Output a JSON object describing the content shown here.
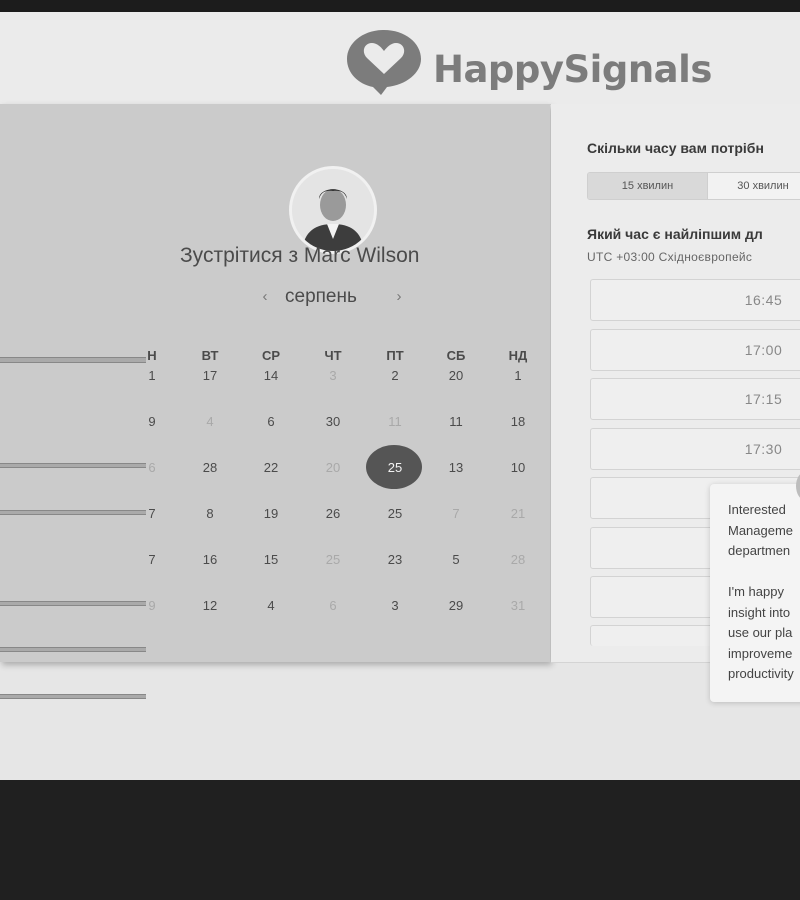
{
  "brand": {
    "name": "HappySignals"
  },
  "left": {
    "meet_title": "Зустрітися з Marc Wilson",
    "month": "серпень",
    "prev_icon": "chevron-left-icon",
    "next_icon": "chevron-right-icon",
    "weekdays": [
      "Н",
      "ВТ",
      "СР",
      "ЧТ",
      "ПТ",
      "СБ",
      "НД"
    ],
    "rows": [
      [
        {
          "d": "1",
          "dim": false
        },
        {
          "d": "17",
          "dim": false
        },
        {
          "d": "14",
          "dim": false
        },
        {
          "d": "3",
          "dim": true
        },
        {
          "d": "2",
          "dim": false
        },
        {
          "d": "20",
          "dim": false
        },
        {
          "d": "1",
          "dim": false
        }
      ],
      [
        {
          "d": "9",
          "dim": false
        },
        {
          "d": "4",
          "dim": true
        },
        {
          "d": "6",
          "dim": false
        },
        {
          "d": "30",
          "dim": false
        },
        {
          "d": "11",
          "dim": true
        },
        {
          "d": "11",
          "dim": false
        },
        {
          "d": "18",
          "dim": false
        }
      ],
      [
        {
          "d": "6",
          "dim": true
        },
        {
          "d": "28",
          "dim": false
        },
        {
          "d": "22",
          "dim": false
        },
        {
          "d": "20",
          "dim": true
        },
        {
          "d": "25",
          "dim": false,
          "selected": true
        },
        {
          "d": "13",
          "dim": false
        },
        {
          "d": "10",
          "dim": false
        }
      ],
      [
        {
          "d": "7",
          "dim": false
        },
        {
          "d": "8",
          "dim": false
        },
        {
          "d": "19",
          "dim": false
        },
        {
          "d": "26",
          "dim": false
        },
        {
          "d": "25",
          "dim": false
        },
        {
          "d": "7",
          "dim": true
        },
        {
          "d": "21",
          "dim": true
        }
      ],
      [
        {
          "d": "7",
          "dim": false
        },
        {
          "d": "16",
          "dim": false
        },
        {
          "d": "15",
          "dim": false
        },
        {
          "d": "25",
          "dim": true
        },
        {
          "d": "23",
          "dim": false
        },
        {
          "d": "5",
          "dim": false
        },
        {
          "d": "28",
          "dim": true
        }
      ],
      [
        {
          "d": "9",
          "dim": true
        },
        {
          "d": "12",
          "dim": false
        },
        {
          "d": "4",
          "dim": false
        },
        {
          "d": "6",
          "dim": true
        },
        {
          "d": "3",
          "dim": false
        },
        {
          "d": "29",
          "dim": false
        },
        {
          "d": "31",
          "dim": true
        }
      ]
    ]
  },
  "right": {
    "duration_question": "Скільки часу вам потрібн",
    "durations": [
      "15 хвилин",
      "30 хвилин"
    ],
    "active_duration": "15 хвилин",
    "time_question": "Який час є найліпшим дл",
    "timezone": "UTC +03:00 Східноєвропейс",
    "slots": [
      "16:45",
      "17:00",
      "17:15",
      "17:30",
      "",
      "",
      ""
    ]
  },
  "chat": {
    "lines": [
      "Interested",
      "Manageme",
      "departmen",
      "",
      "I'm happy",
      "insight into",
      "use our pla",
      "improveme",
      "productivity"
    ]
  }
}
